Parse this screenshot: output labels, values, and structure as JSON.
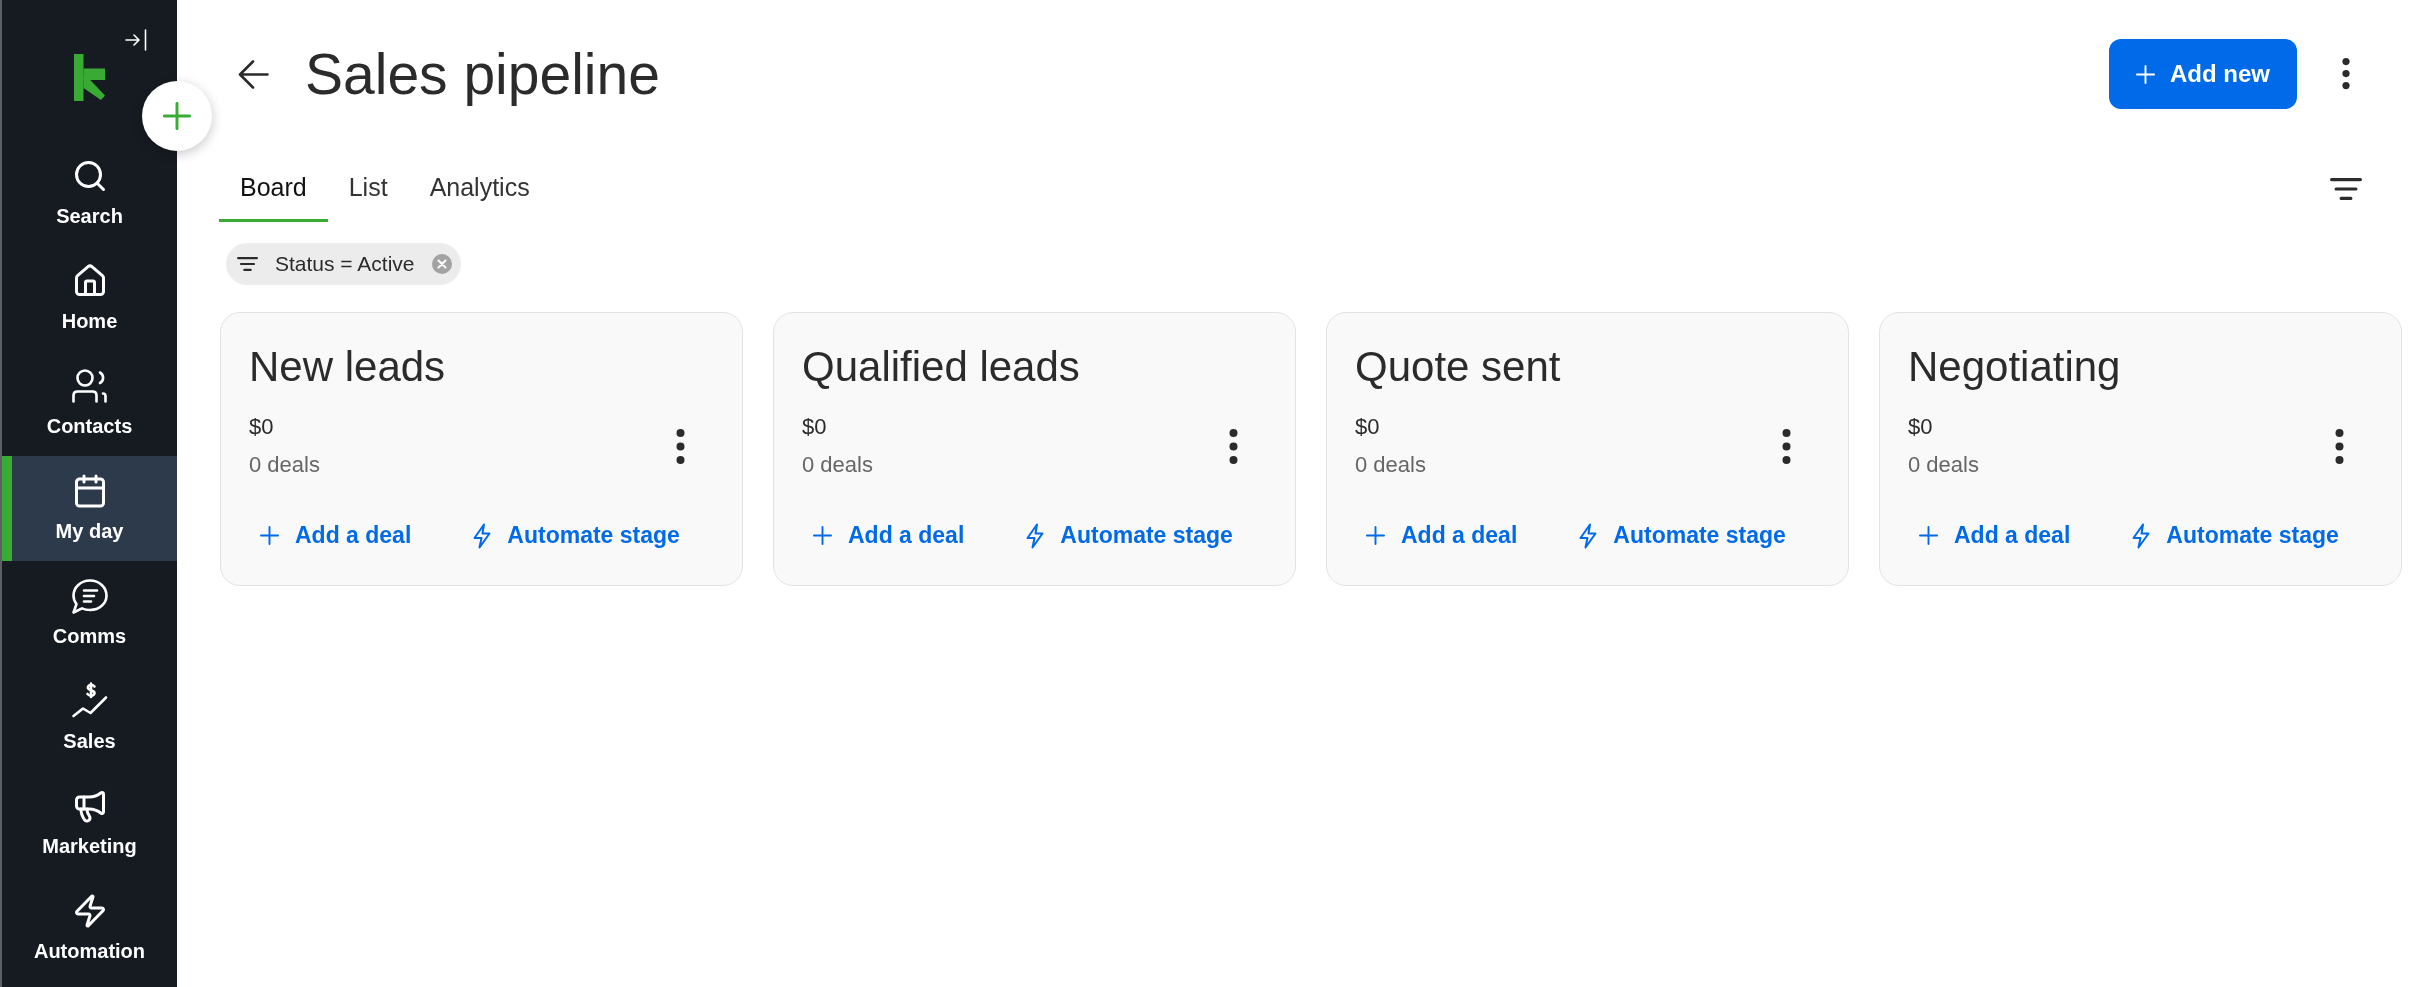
{
  "sidebar": {
    "items": [
      {
        "label": "Search",
        "selected": false
      },
      {
        "label": "Home",
        "selected": false
      },
      {
        "label": "Contacts",
        "selected": false
      },
      {
        "label": "My day",
        "selected": true
      },
      {
        "label": "Comms",
        "selected": false
      },
      {
        "label": "Sales",
        "selected": false
      },
      {
        "label": "Marketing",
        "selected": false
      },
      {
        "label": "Automation",
        "selected": false
      }
    ]
  },
  "header": {
    "title": "Sales pipeline",
    "add_button": "Add new"
  },
  "tabs": [
    {
      "label": "Board",
      "selected": true
    },
    {
      "label": "List",
      "selected": false
    },
    {
      "label": "Analytics",
      "selected": false
    }
  ],
  "filters": [
    {
      "label": "Status = Active"
    }
  ],
  "stages": [
    {
      "name": "New leads",
      "amount": "$0",
      "deal_count": "0 deals",
      "actions": [
        {
          "kind": "add",
          "label": "Add a deal"
        },
        {
          "kind": "automate",
          "label": "Automate stage"
        }
      ]
    },
    {
      "name": "Qualified leads",
      "amount": "$0",
      "deal_count": "0 deals",
      "actions": [
        {
          "kind": "add",
          "label": "Add a deal"
        },
        {
          "kind": "automate",
          "label": "Automate stage"
        }
      ]
    },
    {
      "name": "Quote sent",
      "amount": "$0",
      "deal_count": "0 deals",
      "actions": [
        {
          "kind": "add",
          "label": "Add a deal"
        },
        {
          "kind": "automate",
          "label": "Automate stage"
        }
      ]
    },
    {
      "name": "Negotiating",
      "amount": "$0",
      "deal_count": "0 deals",
      "actions": [
        {
          "kind": "add",
          "label": "Add a deal"
        },
        {
          "kind": "automate",
          "label": "Automate stage"
        }
      ]
    }
  ]
}
